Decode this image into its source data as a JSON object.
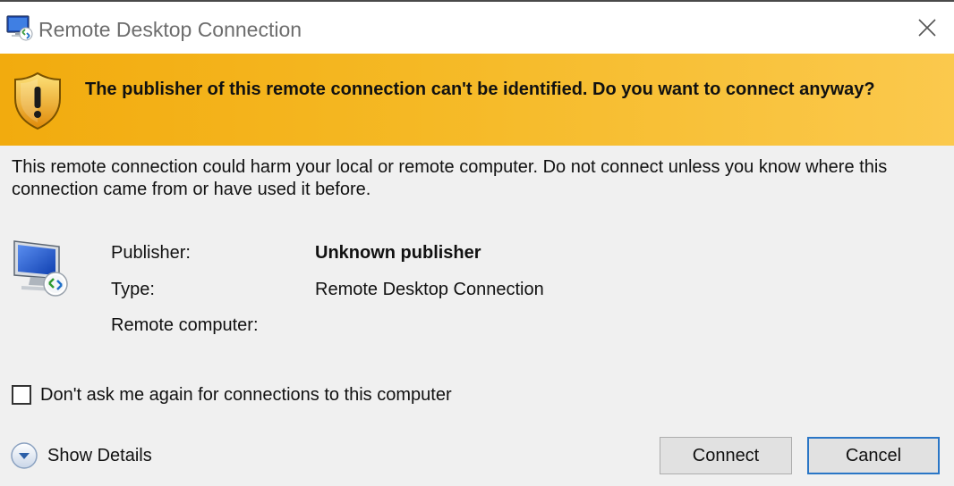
{
  "window": {
    "title": "Remote Desktop Connection"
  },
  "banner": {
    "message": "The publisher of this remote connection can't be identified. Do you want to connect anyway?",
    "icon": "warning-shield-icon",
    "gradient_start": "#f2ab0e",
    "gradient_end": "#fbc94d"
  },
  "warning_text": "This remote connection could harm your local or remote computer. Do not connect unless you know where this connection came from or have used it before.",
  "info": {
    "rows": [
      {
        "label": "Publisher:",
        "value": "Unknown publisher"
      },
      {
        "label": "Type:",
        "value": "Remote Desktop Connection"
      },
      {
        "label": "Remote computer:",
        "value": ""
      }
    ]
  },
  "options": {
    "dont_ask_label": "Don't ask me again for connections to this computer",
    "dont_ask_checked": false
  },
  "footer": {
    "show_details_label": "Show Details",
    "connect_label": "Connect",
    "cancel_label": "Cancel",
    "focus_color": "#2a76c6"
  }
}
